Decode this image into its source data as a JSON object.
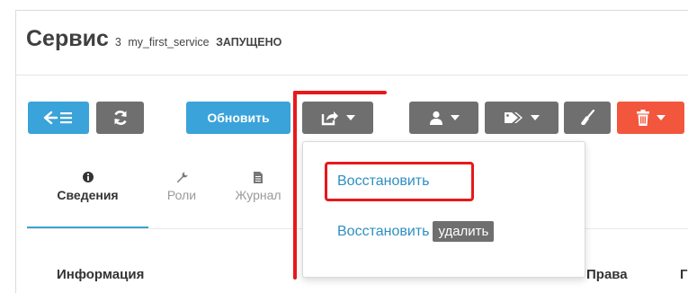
{
  "header": {
    "title": "Сервис",
    "count": "3",
    "service_name": "my_first_service",
    "status": "ЗАПУЩЕНО"
  },
  "toolbar": {
    "back_icon": "back-list-icon",
    "refresh_icon": "refresh-icon",
    "update_label": "Обновить",
    "share_icon": "share-icon",
    "user_icon": "user-icon",
    "tag_icon": "tag-icon",
    "brush_icon": "broom-icon",
    "trash_icon": "trash-icon"
  },
  "dropdown": {
    "restore_label": "Восстановить",
    "restore_delete_label": "Восстановить",
    "delete_tag": "удалить"
  },
  "tabs": [
    {
      "label": "Сведения",
      "icon": "info-icon"
    },
    {
      "label": "Роли",
      "icon": "wrench-icon"
    },
    {
      "label": "Журнал",
      "icon": "file-icon"
    }
  ],
  "content": {
    "section_title": "Информация",
    "rights_label": "Права",
    "col_partial": "Г"
  },
  "colors": {
    "blue": "#3aa3d9",
    "gray": "#6f6f6f",
    "red": "#f2573e",
    "annotation": "#e8181b"
  }
}
